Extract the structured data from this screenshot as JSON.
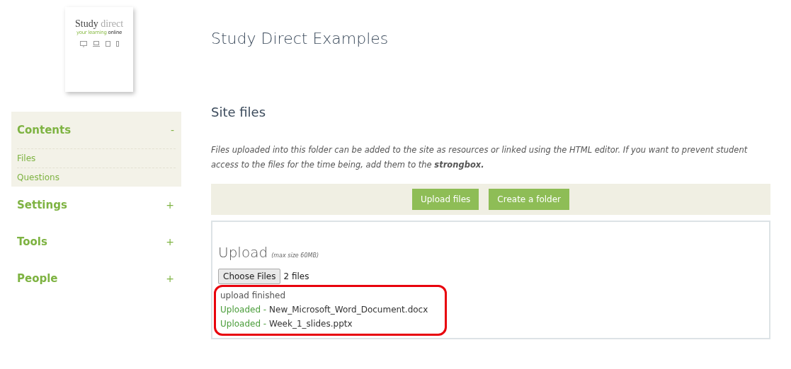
{
  "logo": {
    "title_dark": "Study",
    "title_light": "direct",
    "tagline_green": "your learning",
    "tagline_dark": "online"
  },
  "sidebar": [
    {
      "label": "Contents",
      "toggle": "-",
      "expanded": true,
      "children": [
        {
          "label": "Files"
        },
        {
          "label": "Questions"
        }
      ]
    },
    {
      "label": "Settings",
      "toggle": "+",
      "expanded": false
    },
    {
      "label": "Tools",
      "toggle": "+",
      "expanded": false
    },
    {
      "label": "People",
      "toggle": "+",
      "expanded": false
    }
  ],
  "page_title": "Study Direct Examples",
  "section_title": "Site files",
  "description": "Files uploaded into this folder can be added to the site as resources or linked using the HTML editor. If you want to prevent student access to the files for the time being, add them to the **strongbox.**",
  "buttons": [
    "Upload files",
    "Create a folder"
  ],
  "upload": {
    "title": "Upload",
    "note": "(max size 60MB)",
    "choose_button": "Choose Files",
    "chosen": "2 files",
    "status": "upload finished",
    "files": [
      {
        "status": "Uploaded -",
        "name": "New_Microsoft_Word_Document.docx"
      },
      {
        "status": "Uploaded -",
        "name": "Week_1_slides.pptx"
      }
    ]
  }
}
